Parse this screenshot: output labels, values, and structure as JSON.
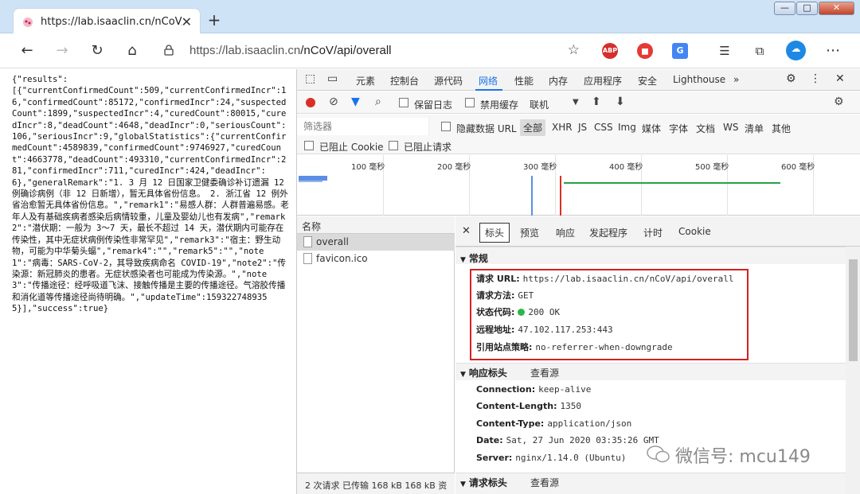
{
  "browser": {
    "tab_title": "https://lab.isaaclin.cn/nCoV/api/o",
    "url_prefix": "https://lab.isaaclin.cn",
    "url_path": "/nCoV/api/overall",
    "window_min": "—",
    "window_max": "□",
    "window_close": "✕",
    "abp_label": "ABP"
  },
  "json_text": "{\"results\":\n[{\"currentConfirmedCount\":509,\"currentConfirmedIncr\":16,\"confirmedCount\":85172,\"confirmedIncr\":24,\"suspectedCount\":1899,\"suspectedIncr\":4,\"curedCount\":80015,\"curedIncr\":8,\"deadCount\":4648,\"deadIncr\":0,\"seriousCount\":106,\"seriousIncr\":9,\"globalStatistics\":{\"currentConfirmedCount\":4589839,\"confirmedCount\":9746927,\"curedCount\":4663778,\"deadCount\":493310,\"currentConfirmedIncr\":281,\"confirmedIncr\":711,\"curedIncr\":424,\"deadIncr\":6},\"generalRemark\":\"1. 3 月 12 日国家卫健委确诊补订遗漏 12 例确诊病例（非 12 日新增），暂无具体省份信息。 2. 浙江省 12 例外省治愈暂无具体省份信息。\",\"remark1\":\"易感人群：人群普遍易感。老年人及有基础疾病者感染后病情较重，儿童及婴幼儿也有发病\",\"remark2\":\"潜伏期：一般为 3～7 天，最长不超过 14 天，潜伏期内可能存在传染性，其中无症状病例传染性非常罕见\",\"remark3\":\"宿主：野生动物，可能为中华菊头蝠\",\"remark4\":\"\",\"remark5\":\"\",\"note1\":\"病毒：SARS-CoV-2，其导致疾病命名 COVID-19\",\"note2\":\"传染源：新冠肺炎的患者。无症状感染者也可能成为传染源。\",\"note3\":\"传播途径：经呼吸道飞沫、接触传播是主要的传播途径。气溶胶传播和消化道等传播途径尚待明确。\",\"updateTime\":1593227489355}],\"success\":true}",
  "devtools": {
    "tabs": [
      "元素",
      "控制台",
      "源代码",
      "网络",
      "性能",
      "内存",
      "应用程序",
      "安全",
      "Lighthouse"
    ],
    "more": "»",
    "toolbar": {
      "preserve_log": "保留日志",
      "disable_cache": "禁用缓存",
      "throttle": "联机"
    },
    "filter": {
      "placeholder": "筛选器",
      "hide_data_urls": "隐藏数据 URL",
      "types": [
        "全部",
        "XHR",
        "JS",
        "CSS",
        "Img",
        "媒体",
        "字体",
        "文档",
        "WS",
        "清单",
        "其他"
      ],
      "blocked_cookies": "已阻止 Cookie",
      "blocked_requests": "已阻止请求"
    },
    "timeline_ticks": [
      "100 毫秒",
      "200 毫秒",
      "300 毫秒",
      "400 毫秒",
      "500 毫秒",
      "600 毫秒"
    ],
    "requests": {
      "header": "名称",
      "items": [
        "overall",
        "favicon.ico"
      ],
      "status": "2 次请求  已传输 168 kB  168 kB 资"
    },
    "details": {
      "tabs": [
        "标头",
        "预览",
        "响应",
        "发起程序",
        "计时",
        "Cookie"
      ],
      "general_title": "常规",
      "general": [
        {
          "k": "请求 URL:",
          "v": "https://lab.isaaclin.cn/nCoV/api/overall"
        },
        {
          "k": "请求方法:",
          "v": "GET"
        },
        {
          "k": "状态代码:",
          "v": "200 OK"
        },
        {
          "k": "远程地址:",
          "v": "47.102.117.253:443"
        },
        {
          "k": "引用站点策略:",
          "v": "no-referrer-when-downgrade"
        }
      ],
      "response_title": "响应标头",
      "view_source": "查看源",
      "response": [
        {
          "k": "Connection:",
          "v": "keep-alive"
        },
        {
          "k": "Content-Length:",
          "v": "1350"
        },
        {
          "k": "Content-Type:",
          "v": "application/json"
        },
        {
          "k": "Date:",
          "v": "Sat, 27 Jun 2020 03:35:26 GMT"
        },
        {
          "k": "Server:",
          "v": "nginx/1.14.0 (Ubuntu)"
        }
      ],
      "request_title": "请求标头"
    }
  },
  "watermark": "微信号: mcu149",
  "colors": {
    "accent": "#1a73e8",
    "record": "#d93025",
    "highlight": "#d62020",
    "status_ok": "#2fb54a"
  }
}
